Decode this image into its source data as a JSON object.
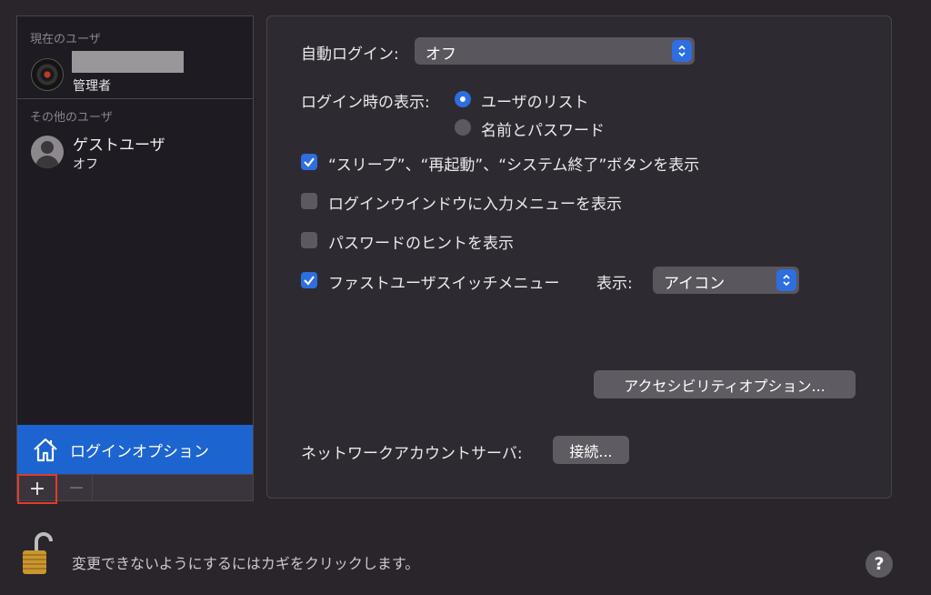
{
  "sidebar": {
    "current_users_label": "現在のユーザ",
    "admin": {
      "role": "管理者"
    },
    "other_users_label": "その他のユーザ",
    "guest": {
      "name": "ゲストユーザ",
      "status": "オフ"
    },
    "login_options_label": "ログインオプション",
    "add_label": "+",
    "remove_label": "−"
  },
  "panel": {
    "auto_login": {
      "label": "自動ログイン:",
      "value": "オフ"
    },
    "login_display": {
      "label": "ログイン時の表示:",
      "options": [
        "ユーザのリスト",
        "名前とパスワード"
      ],
      "selected": "ユーザのリスト"
    },
    "checkboxes": [
      {
        "label": "“スリープ”、“再起動”、“システム終了”ボタンを表示",
        "checked": true
      },
      {
        "label": "ログインウインドウに入力メニューを表示",
        "checked": false
      },
      {
        "label": "パスワードのヒントを表示",
        "checked": false
      },
      {
        "label": "ファストユーザスイッチメニュー",
        "checked": true
      }
    ],
    "fast_switch_display": {
      "label": "表示:",
      "value": "アイコン"
    },
    "accessibility_button": "アクセシビリティオプション...",
    "network_server": {
      "label": "ネットワークアカウントサーバ:",
      "button": "接続..."
    }
  },
  "footer": {
    "lock_text": "変更できないようにするにはカギをクリックします。",
    "help_label": "?"
  },
  "colors": {
    "accent": "#2d6ee0",
    "selection": "#1c64d0",
    "background": "#2a252b"
  },
  "icons": [
    "admin-avatar-icon",
    "guest-avatar-icon",
    "house-icon",
    "lock-icon",
    "help-icon",
    "checkmark-icon",
    "stepper-icon"
  ]
}
